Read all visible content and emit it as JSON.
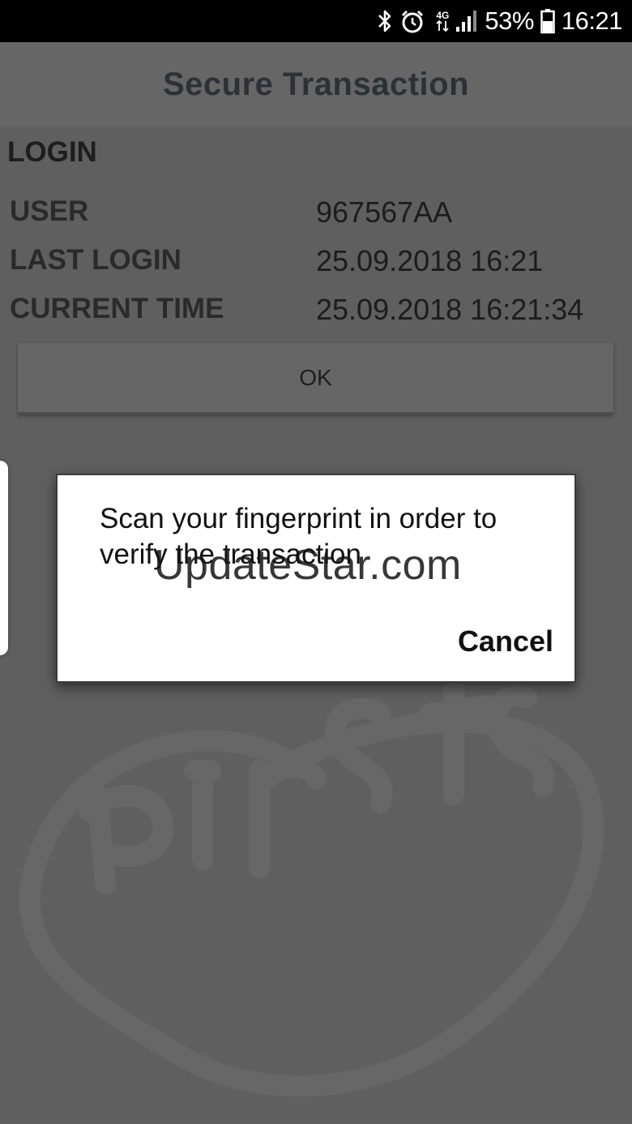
{
  "status_bar": {
    "network_label": "4G",
    "battery_percent": "53%",
    "time": "16:21",
    "icons": [
      "bluetooth-icon",
      "alarm-icon",
      "network-4g-icon",
      "signal-icon",
      "battery-icon"
    ]
  },
  "header": {
    "title": "Secure Transaction"
  },
  "login": {
    "section_title": "LOGIN",
    "rows": [
      {
        "label": "USER",
        "value": "967567AA"
      },
      {
        "label": "LAST LOGIN",
        "value": "25.09.2018 16:21"
      },
      {
        "label": "CURRENT TIME",
        "value": "25.09.2018 16:21:34"
      }
    ],
    "ok_label": "OK"
  },
  "dialog": {
    "message": "Scan your fingerprint in order to verify the transaction",
    "cancel_label": "Cancel"
  },
  "watermark": {
    "text": "UpdateStar.com"
  },
  "colors": {
    "background": "#5f5f5f",
    "header": "#666666",
    "status_bar": "#000000",
    "dialog": "#ffffff"
  }
}
